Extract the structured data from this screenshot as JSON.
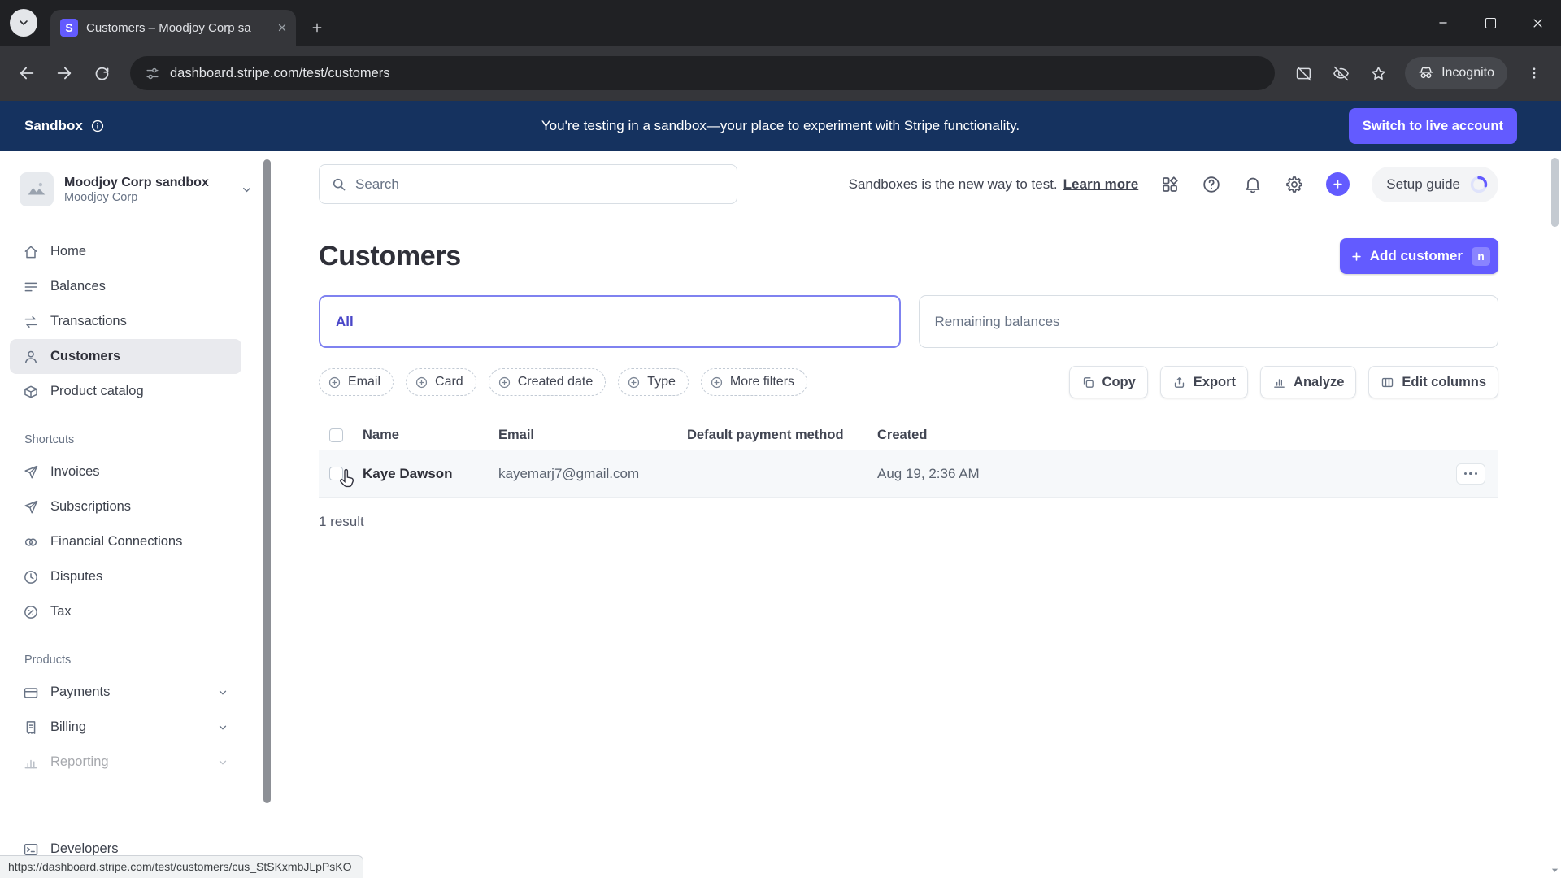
{
  "browser": {
    "tab_title": "Customers – Moodjoy Corp sa",
    "url": "dashboard.stripe.com/test/customers",
    "incognito_label": "Incognito"
  },
  "banner": {
    "label": "Sandbox",
    "message": "You're testing in a sandbox—your place to experiment with Stripe functionality.",
    "cta": "Switch to live account"
  },
  "sidebar": {
    "account_name": "Moodjoy Corp sandbox",
    "account_org": "Moodjoy Corp",
    "items": [
      {
        "label": "Home"
      },
      {
        "label": "Balances"
      },
      {
        "label": "Transactions"
      },
      {
        "label": "Customers"
      },
      {
        "label": "Product catalog"
      }
    ],
    "shortcuts_heading": "Shortcuts",
    "shortcuts": [
      {
        "label": "Invoices"
      },
      {
        "label": "Subscriptions"
      },
      {
        "label": "Financial Connections"
      },
      {
        "label": "Disputes"
      },
      {
        "label": "Tax"
      }
    ],
    "products_heading": "Products",
    "products": [
      {
        "label": "Payments"
      },
      {
        "label": "Billing"
      },
      {
        "label": "Reporting"
      }
    ],
    "developers_label": "Developers"
  },
  "topbar": {
    "search_placeholder": "Search",
    "notice_text": "Sandboxes is the new way to test.",
    "notice_link": "Learn more",
    "setup_guide_label": "Setup guide"
  },
  "page": {
    "title": "Customers",
    "add_customer_label": "Add customer",
    "add_customer_shortcut": "n",
    "tab_all": "All",
    "tab_remaining": "Remaining balances",
    "filter_pills": [
      {
        "label": "Email"
      },
      {
        "label": "Card"
      },
      {
        "label": "Created date"
      },
      {
        "label": "Type"
      },
      {
        "label": "More filters"
      }
    ],
    "actions": {
      "copy": "Copy",
      "export": "Export",
      "analyze": "Analyze",
      "edit_columns": "Edit columns"
    },
    "table": {
      "columns": [
        "Name",
        "Email",
        "Default payment method",
        "Created"
      ],
      "rows": [
        {
          "name": "Kaye Dawson",
          "email": "kayemarj7@gmail.com",
          "payment_method": "",
          "created": "Aug 19, 2:36 AM"
        }
      ]
    },
    "result_count": "1 result"
  },
  "status_link": "https://dashboard.stripe.com/test/customers/cus_StSKxmbJLpPsKO",
  "colors": {
    "accent": "#635bff",
    "banner_bg": "#15325f"
  }
}
